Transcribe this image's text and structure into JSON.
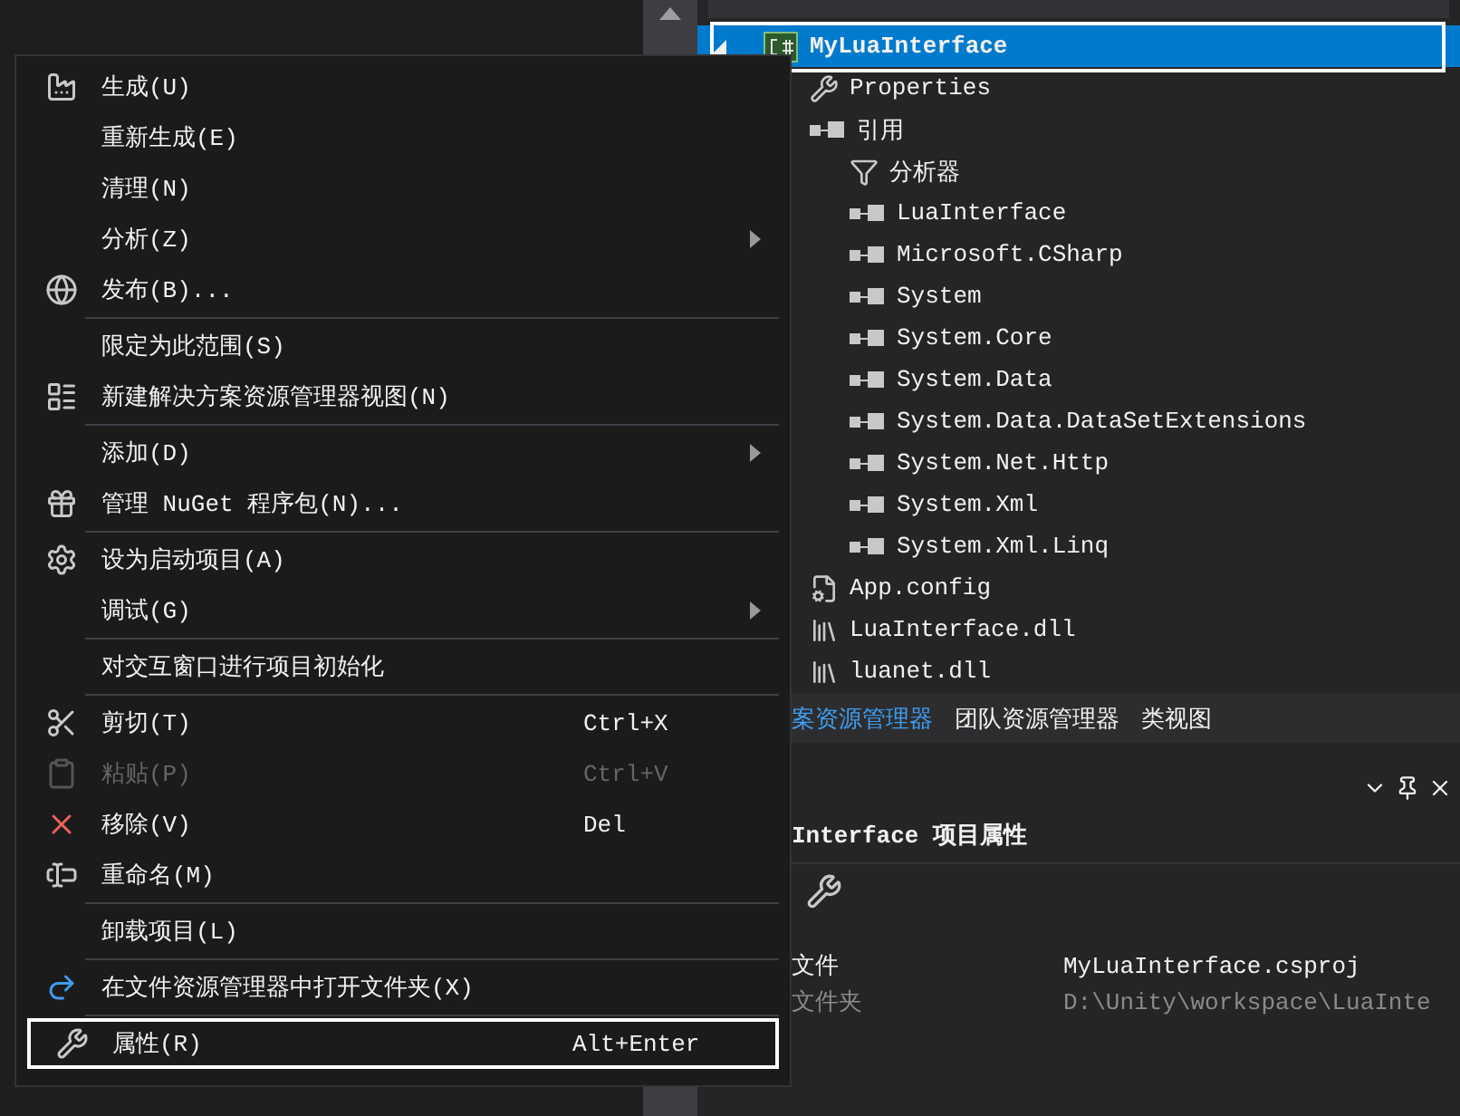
{
  "context_menu": {
    "groups": [
      [
        {
          "label": "生成(U)",
          "submenu": false,
          "disabled": false,
          "selected": false
        },
        {
          "label": "重新生成(E)",
          "submenu": false,
          "disabled": false,
          "selected": false
        },
        {
          "label": "清理(N)",
          "submenu": false,
          "disabled": false,
          "selected": false
        },
        {
          "label": "分析(Z)",
          "submenu": true,
          "disabled": false,
          "selected": false
        },
        {
          "label": "发布(B)...",
          "submenu": false,
          "disabled": false,
          "selected": false
        }
      ],
      [
        {
          "label": "限定为此范围(S)",
          "submenu": false,
          "disabled": false,
          "selected": false
        },
        {
          "label": "新建解决方案资源管理器视图(N)",
          "submenu": false,
          "disabled": false,
          "selected": false
        }
      ],
      [
        {
          "label": "添加(D)",
          "submenu": true,
          "disabled": false,
          "selected": false
        },
        {
          "label": "管理 NuGet 程序包(N)...",
          "submenu": false,
          "disabled": false,
          "selected": false
        }
      ],
      [
        {
          "label": "设为启动项目(A)",
          "submenu": false,
          "disabled": false,
          "selected": false
        },
        {
          "label": "调试(G)",
          "submenu": true,
          "disabled": false,
          "selected": false
        }
      ],
      [
        {
          "label": "对交互窗口进行项目初始化",
          "submenu": false,
          "disabled": false,
          "selected": false
        }
      ],
      [
        {
          "label": "剪切(T)",
          "shortcut": "Ctrl+X",
          "submenu": false,
          "disabled": false,
          "selected": false
        },
        {
          "label": "粘贴(P)",
          "shortcut": "Ctrl+V",
          "submenu": false,
          "disabled": true,
          "selected": false
        },
        {
          "label": "移除(V)",
          "shortcut": "Del",
          "submenu": false,
          "disabled": false,
          "selected": false
        },
        {
          "label": "重命名(M)",
          "submenu": false,
          "disabled": false,
          "selected": false
        }
      ],
      [
        {
          "label": "卸载项目(L)",
          "submenu": false,
          "disabled": false,
          "selected": false
        }
      ],
      [
        {
          "label": "在文件资源管理器中打开文件夹(X)",
          "submenu": false,
          "disabled": false,
          "selected": false
        }
      ],
      [
        {
          "label": "属性(R)",
          "shortcut": "Alt+Enter",
          "submenu": false,
          "disabled": false,
          "selected": true
        }
      ]
    ]
  },
  "solution_explorer": {
    "tree": [
      {
        "kind": "project",
        "label": "MyLuaInterface",
        "selected": true,
        "children": [
          {
            "kind": "properties",
            "label": "Properties",
            "selected": false
          },
          {
            "kind": "references",
            "label": "引用",
            "selected": false,
            "children": [
              {
                "kind": "analyzer",
                "label": "分析器",
                "selected": false
              },
              {
                "kind": "reference",
                "label": "LuaInterface",
                "selected": false
              },
              {
                "kind": "reference",
                "label": "Microsoft.CSharp",
                "selected": false
              },
              {
                "kind": "reference",
                "label": "System",
                "selected": false
              },
              {
                "kind": "reference",
                "label": "System.Core",
                "selected": false
              },
              {
                "kind": "reference",
                "label": "System.Data",
                "selected": false
              },
              {
                "kind": "reference",
                "label": "System.Data.DataSetExtensions",
                "selected": false
              },
              {
                "kind": "reference",
                "label": "System.Net.Http",
                "selected": false
              },
              {
                "kind": "reference",
                "label": "System.Xml",
                "selected": false
              },
              {
                "kind": "reference",
                "label": "System.Xml.Linq",
                "selected": false
              }
            ]
          },
          {
            "kind": "config",
            "label": "App.config",
            "selected": false
          },
          {
            "kind": "dll",
            "label": "LuaInterface.dll",
            "selected": false
          },
          {
            "kind": "dll",
            "label": "luanet.dll",
            "selected": false
          }
        ]
      }
    ]
  },
  "tabs": [
    {
      "label": "案资源管理器",
      "selected": true
    },
    {
      "label": "团队资源管理器",
      "selected": false
    },
    {
      "label": "类视图",
      "selected": false
    }
  ],
  "properties_panel": {
    "title": "Interface 项目属性",
    "rows": [
      {
        "name": "文件",
        "value": "MyLuaInterface.csproj",
        "disabled": false
      },
      {
        "name": "文件夹",
        "value": "D:\\Unity\\workspace\\LuaInte",
        "disabled": true
      }
    ]
  }
}
